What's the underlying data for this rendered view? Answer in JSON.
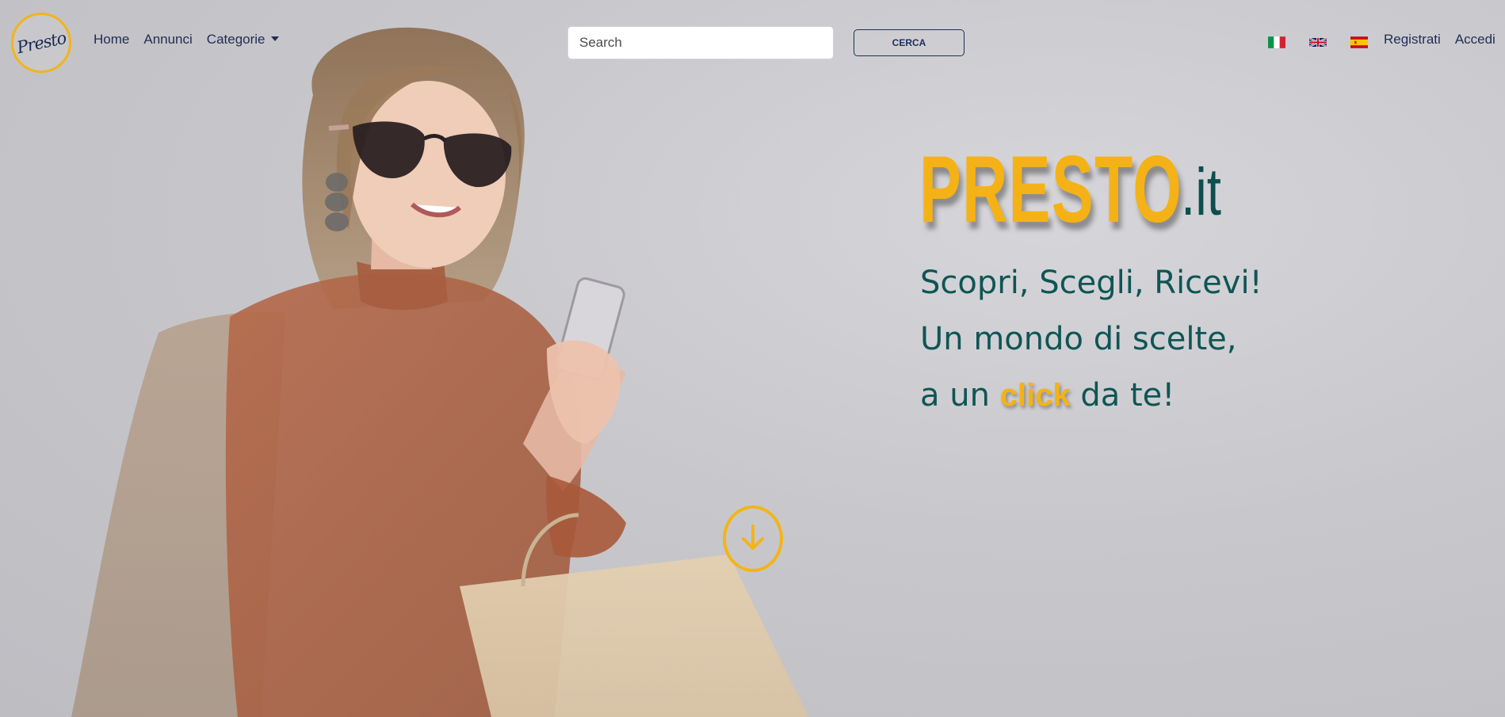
{
  "navbar": {
    "logo_text": "Presto",
    "links": [
      {
        "label": "Home"
      },
      {
        "label": "Annunci"
      },
      {
        "label": "Categorie"
      }
    ],
    "search": {
      "placeholder": "Search",
      "button_label": "CERCA"
    },
    "languages": [
      {
        "code": "it",
        "icon": "italy-flag-icon"
      },
      {
        "code": "en",
        "icon": "uk-flag-icon"
      },
      {
        "code": "es",
        "icon": "spain-flag-icon"
      }
    ],
    "auth": {
      "register_label": "Registrati",
      "login_label": "Accedi"
    }
  },
  "hero": {
    "brand_main": "PRESTO",
    "brand_suffix": ".it",
    "tagline_line1": "Scopri, Scegli, Ricevi!",
    "tagline_line2": "Un mondo di scelte,",
    "tagline_line3_prefix": "a un",
    "tagline_line3_highlight": "click",
    "tagline_line3_suffix": "da te!",
    "scroll_icon": "arrow-down-circle-icon"
  },
  "colors": {
    "accent_yellow": "#f5b216",
    "teal_text": "#0f5555",
    "navy": "#1f2d55"
  }
}
